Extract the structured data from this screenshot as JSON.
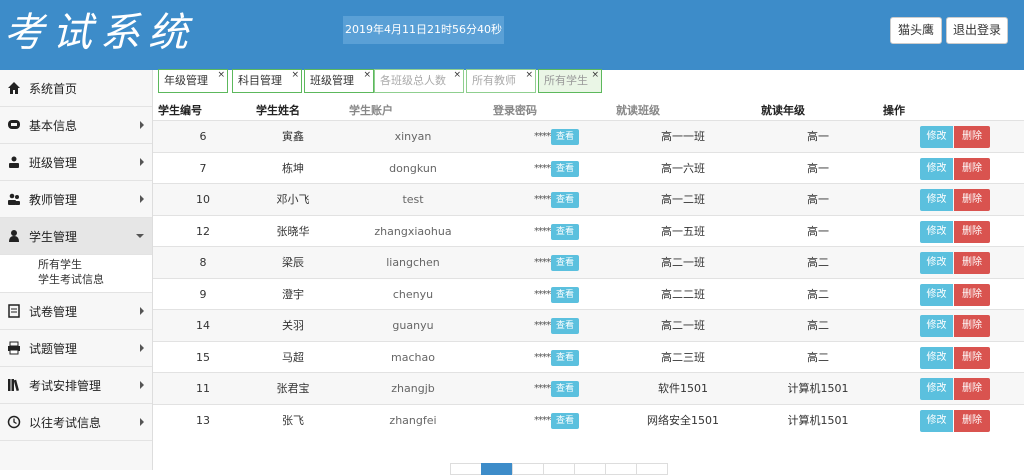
{
  "header": {
    "logo": "考试系统",
    "datetime": "2019年4月11日21时56分40秒",
    "user_button": "猫头鹰",
    "logout_button": "退出登录"
  },
  "sidebar": {
    "items": [
      {
        "label": "系统首页",
        "icon": "home-icon"
      },
      {
        "label": "基本信息",
        "icon": "monitor-icon"
      },
      {
        "label": "班级管理",
        "icon": "group-icon"
      },
      {
        "label": "教师管理",
        "icon": "users-icon"
      },
      {
        "label": "学生管理",
        "icon": "user-icon"
      },
      {
        "label": "试卷管理",
        "icon": "document-icon"
      },
      {
        "label": "试题管理",
        "icon": "printer-icon"
      },
      {
        "label": "考试安排管理",
        "icon": "books-icon"
      },
      {
        "label": "以往考试信息",
        "icon": "clock-icon"
      }
    ],
    "submenu": [
      "所有学生",
      "学生考试信息"
    ]
  },
  "tabs": [
    {
      "label": "年级管理"
    },
    {
      "label": "科目管理"
    },
    {
      "label": "班级管理"
    },
    {
      "label": "各班级总人数"
    },
    {
      "label": "所有教师"
    },
    {
      "label": "所有学生"
    }
  ],
  "table": {
    "headers": [
      "学生编号",
      "学生姓名",
      "学生账户",
      "登录密码",
      "就读班级",
      "就读年级",
      "操作"
    ],
    "view_label": "查看",
    "edit_label": "修改",
    "delete_label": "删除",
    "rows": [
      {
        "id": "6",
        "name": "寅鑫",
        "account": "xinyan",
        "password": "******",
        "class": "高一一班",
        "grade": "高一"
      },
      {
        "id": "7",
        "name": "栋坤",
        "account": "dongkun",
        "password": "******",
        "class": "高一六班",
        "grade": "高一"
      },
      {
        "id": "10",
        "name": "邓小飞",
        "account": "test",
        "password": "******",
        "class": "高一二班",
        "grade": "高一"
      },
      {
        "id": "12",
        "name": "张晓华",
        "account": "zhangxiaohua",
        "password": "******",
        "class": "高一五班",
        "grade": "高一"
      },
      {
        "id": "8",
        "name": "梁辰",
        "account": "liangchen",
        "password": "******",
        "class": "高二一班",
        "grade": "高二"
      },
      {
        "id": "9",
        "name": "澄宇",
        "account": "chenyu",
        "password": "******",
        "class": "高二二班",
        "grade": "高二"
      },
      {
        "id": "14",
        "name": "关羽",
        "account": "guanyu",
        "password": "******",
        "class": "高二一班",
        "grade": "高二"
      },
      {
        "id": "15",
        "name": "马超",
        "account": "machao",
        "password": "******",
        "class": "高二三班",
        "grade": "高二"
      },
      {
        "id": "11",
        "name": "张君宝",
        "account": "zhangjb",
        "password": "******",
        "class": "软件1501",
        "grade": "计算机1501"
      },
      {
        "id": "13",
        "name": "张飞",
        "account": "zhangfei",
        "password": "******",
        "class": "网络安全1501",
        "grade": "计算机1501"
      }
    ]
  }
}
